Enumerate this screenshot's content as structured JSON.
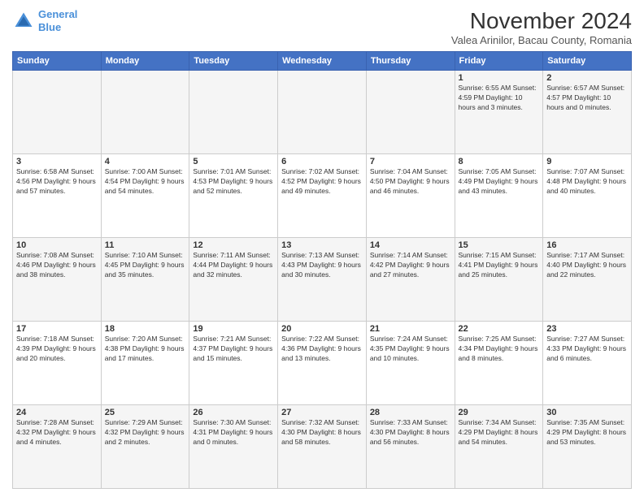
{
  "header": {
    "logo_line1": "General",
    "logo_line2": "Blue",
    "month": "November 2024",
    "location": "Valea Arinilor, Bacau County, Romania"
  },
  "weekdays": [
    "Sunday",
    "Monday",
    "Tuesday",
    "Wednesday",
    "Thursday",
    "Friday",
    "Saturday"
  ],
  "weeks": [
    [
      {
        "day": "",
        "info": ""
      },
      {
        "day": "",
        "info": ""
      },
      {
        "day": "",
        "info": ""
      },
      {
        "day": "",
        "info": ""
      },
      {
        "day": "",
        "info": ""
      },
      {
        "day": "1",
        "info": "Sunrise: 6:55 AM\nSunset: 4:59 PM\nDaylight: 10 hours\nand 3 minutes."
      },
      {
        "day": "2",
        "info": "Sunrise: 6:57 AM\nSunset: 4:57 PM\nDaylight: 10 hours\nand 0 minutes."
      }
    ],
    [
      {
        "day": "3",
        "info": "Sunrise: 6:58 AM\nSunset: 4:56 PM\nDaylight: 9 hours\nand 57 minutes."
      },
      {
        "day": "4",
        "info": "Sunrise: 7:00 AM\nSunset: 4:54 PM\nDaylight: 9 hours\nand 54 minutes."
      },
      {
        "day": "5",
        "info": "Sunrise: 7:01 AM\nSunset: 4:53 PM\nDaylight: 9 hours\nand 52 minutes."
      },
      {
        "day": "6",
        "info": "Sunrise: 7:02 AM\nSunset: 4:52 PM\nDaylight: 9 hours\nand 49 minutes."
      },
      {
        "day": "7",
        "info": "Sunrise: 7:04 AM\nSunset: 4:50 PM\nDaylight: 9 hours\nand 46 minutes."
      },
      {
        "day": "8",
        "info": "Sunrise: 7:05 AM\nSunset: 4:49 PM\nDaylight: 9 hours\nand 43 minutes."
      },
      {
        "day": "9",
        "info": "Sunrise: 7:07 AM\nSunset: 4:48 PM\nDaylight: 9 hours\nand 40 minutes."
      }
    ],
    [
      {
        "day": "10",
        "info": "Sunrise: 7:08 AM\nSunset: 4:46 PM\nDaylight: 9 hours\nand 38 minutes."
      },
      {
        "day": "11",
        "info": "Sunrise: 7:10 AM\nSunset: 4:45 PM\nDaylight: 9 hours\nand 35 minutes."
      },
      {
        "day": "12",
        "info": "Sunrise: 7:11 AM\nSunset: 4:44 PM\nDaylight: 9 hours\nand 32 minutes."
      },
      {
        "day": "13",
        "info": "Sunrise: 7:13 AM\nSunset: 4:43 PM\nDaylight: 9 hours\nand 30 minutes."
      },
      {
        "day": "14",
        "info": "Sunrise: 7:14 AM\nSunset: 4:42 PM\nDaylight: 9 hours\nand 27 minutes."
      },
      {
        "day": "15",
        "info": "Sunrise: 7:15 AM\nSunset: 4:41 PM\nDaylight: 9 hours\nand 25 minutes."
      },
      {
        "day": "16",
        "info": "Sunrise: 7:17 AM\nSunset: 4:40 PM\nDaylight: 9 hours\nand 22 minutes."
      }
    ],
    [
      {
        "day": "17",
        "info": "Sunrise: 7:18 AM\nSunset: 4:39 PM\nDaylight: 9 hours\nand 20 minutes."
      },
      {
        "day": "18",
        "info": "Sunrise: 7:20 AM\nSunset: 4:38 PM\nDaylight: 9 hours\nand 17 minutes."
      },
      {
        "day": "19",
        "info": "Sunrise: 7:21 AM\nSunset: 4:37 PM\nDaylight: 9 hours\nand 15 minutes."
      },
      {
        "day": "20",
        "info": "Sunrise: 7:22 AM\nSunset: 4:36 PM\nDaylight: 9 hours\nand 13 minutes."
      },
      {
        "day": "21",
        "info": "Sunrise: 7:24 AM\nSunset: 4:35 PM\nDaylight: 9 hours\nand 10 minutes."
      },
      {
        "day": "22",
        "info": "Sunrise: 7:25 AM\nSunset: 4:34 PM\nDaylight: 9 hours\nand 8 minutes."
      },
      {
        "day": "23",
        "info": "Sunrise: 7:27 AM\nSunset: 4:33 PM\nDaylight: 9 hours\nand 6 minutes."
      }
    ],
    [
      {
        "day": "24",
        "info": "Sunrise: 7:28 AM\nSunset: 4:32 PM\nDaylight: 9 hours\nand 4 minutes."
      },
      {
        "day": "25",
        "info": "Sunrise: 7:29 AM\nSunset: 4:32 PM\nDaylight: 9 hours\nand 2 minutes."
      },
      {
        "day": "26",
        "info": "Sunrise: 7:30 AM\nSunset: 4:31 PM\nDaylight: 9 hours\nand 0 minutes."
      },
      {
        "day": "27",
        "info": "Sunrise: 7:32 AM\nSunset: 4:30 PM\nDaylight: 8 hours\nand 58 minutes."
      },
      {
        "day": "28",
        "info": "Sunrise: 7:33 AM\nSunset: 4:30 PM\nDaylight: 8 hours\nand 56 minutes."
      },
      {
        "day": "29",
        "info": "Sunrise: 7:34 AM\nSunset: 4:29 PM\nDaylight: 8 hours\nand 54 minutes."
      },
      {
        "day": "30",
        "info": "Sunrise: 7:35 AM\nSunset: 4:29 PM\nDaylight: 8 hours\nand 53 minutes."
      }
    ]
  ]
}
